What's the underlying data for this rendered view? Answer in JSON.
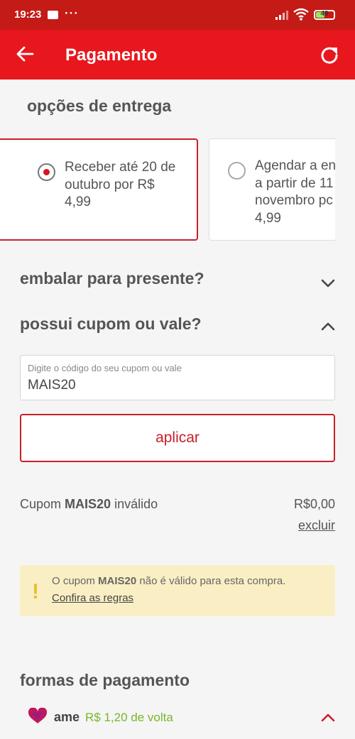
{
  "status_bar": {
    "time": "19:23",
    "dots": "···",
    "battery_level": "49",
    "battery_fraction": 0.49
  },
  "app_bar": {
    "title": "Pagamento",
    "back_icon": "arrow-left-icon",
    "refresh_icon": "refresh-icon"
  },
  "delivery": {
    "title": "opções de entrega",
    "options": [
      {
        "text": "Receber até 20 de\noutubro por R$\n4,99",
        "selected": true
      },
      {
        "text": "Agendar a en\na partir de 11\nnovembro pc\n4,99",
        "selected": false
      }
    ]
  },
  "gift_wrap": {
    "title": "embalar para presente?",
    "expanded": false
  },
  "coupon": {
    "title": "possui cupom ou vale?",
    "expanded": true,
    "field_label": "Digite o código do seu cupom ou vale",
    "field_value": "MAIS20",
    "apply_label": "aplicar",
    "status_prefix": "Cupom ",
    "status_code": "MAIS20",
    "status_suffix": " inválido",
    "amount": "R$0,00",
    "remove_label": "excluir"
  },
  "warning": {
    "icon": "exclamation-icon",
    "prefix": "O cupom ",
    "code": "MAIS20",
    "suffix": " não é válido para esta compra.",
    "link": "Confira as regras"
  },
  "payment": {
    "title": "formas de pagamento",
    "ame_label": "ame",
    "ame_cashback": "R$ 1,20 de volta",
    "expanded": true
  },
  "colors": {
    "status_bar": "#c41b17",
    "app_bar": "#e8171d",
    "accent": "#c8202a",
    "warning_bg": "#faefc4",
    "cashback": "#7bb52a"
  }
}
